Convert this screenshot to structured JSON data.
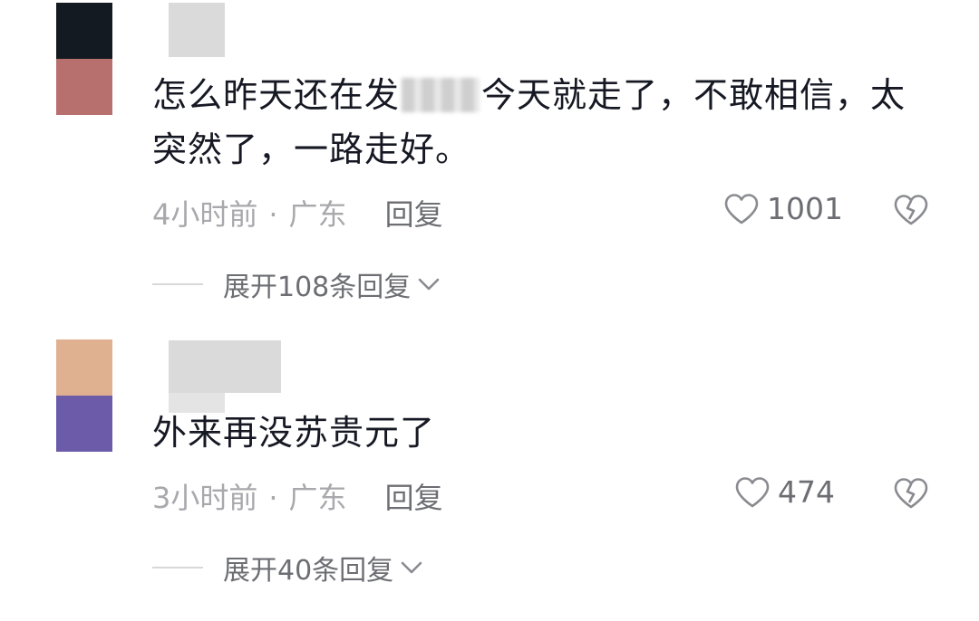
{
  "comments": [
    {
      "avatar_colors": [
        "#141a22",
        "#b8706f"
      ],
      "text_before": "怎么昨天还在发",
      "text_after": "今天就走了，不敢相信，太突然了，一路走好。",
      "time": "4小时前",
      "dot": "·",
      "location": "广东",
      "reply_label": "回复",
      "likes": "1001",
      "expand_label": "展开108条回复",
      "icons": [
        "heart-icon",
        "broken-heart-icon",
        "chevron-down-icon"
      ]
    },
    {
      "avatar_colors": [
        "#e0b190",
        "#6b5ba8"
      ],
      "text": "外来再没苏贵元了",
      "time": "3小时前",
      "dot": "·",
      "location": "广东",
      "reply_label": "回复",
      "likes": "474",
      "expand_label": "展开40条回复",
      "icons": [
        "heart-icon",
        "broken-heart-icon",
        "chevron-down-icon"
      ]
    }
  ]
}
